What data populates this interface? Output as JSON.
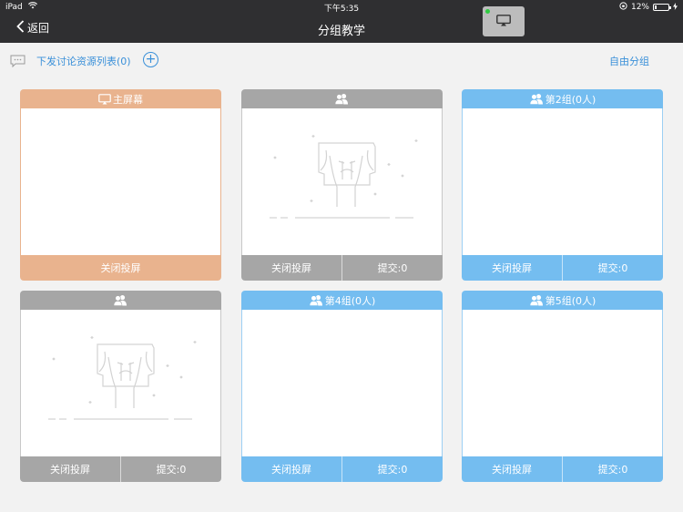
{
  "status_bar": {
    "device": "iPad",
    "time": "下午5:35",
    "battery_text": "12%",
    "battery_level": 0.12
  },
  "nav": {
    "back_label": "返回",
    "title": "分组教学",
    "airplay_icon": "airplay-icon"
  },
  "toolbar": {
    "resource_link": "下发讨论资源列表(0)",
    "add_icon": "plus-circle-icon",
    "free_group": "自由分组"
  },
  "colors": {
    "main_screen": "#e9b38e",
    "inactive_group": "#a6a6a6",
    "active_group": "#74bdf0",
    "link": "#3a90d9"
  },
  "cards": [
    {
      "title": "主屏幕",
      "icon": "monitor-icon",
      "style": "orange",
      "close_label": "关闭投屏",
      "submit_label": "",
      "empty": false
    },
    {
      "title": "",
      "icon": "users-icon",
      "style": "gray",
      "close_label": "关闭投屏",
      "submit_label": "提交:0",
      "empty": true
    },
    {
      "title": "第2组(0人)",
      "icon": "users-icon",
      "style": "blue",
      "close_label": "关闭投屏",
      "submit_label": "提交:0",
      "empty": false
    },
    {
      "title": "",
      "icon": "users-icon",
      "style": "gray",
      "close_label": "关闭投屏",
      "submit_label": "提交:0",
      "empty": true
    },
    {
      "title": "第4组(0人)",
      "icon": "users-icon",
      "style": "blue",
      "close_label": "关闭投屏",
      "submit_label": "提交:0",
      "empty": false
    },
    {
      "title": "第5组(0人)",
      "icon": "users-icon",
      "style": "blue",
      "close_label": "关闭投屏",
      "submit_label": "提交:0",
      "empty": false
    }
  ]
}
